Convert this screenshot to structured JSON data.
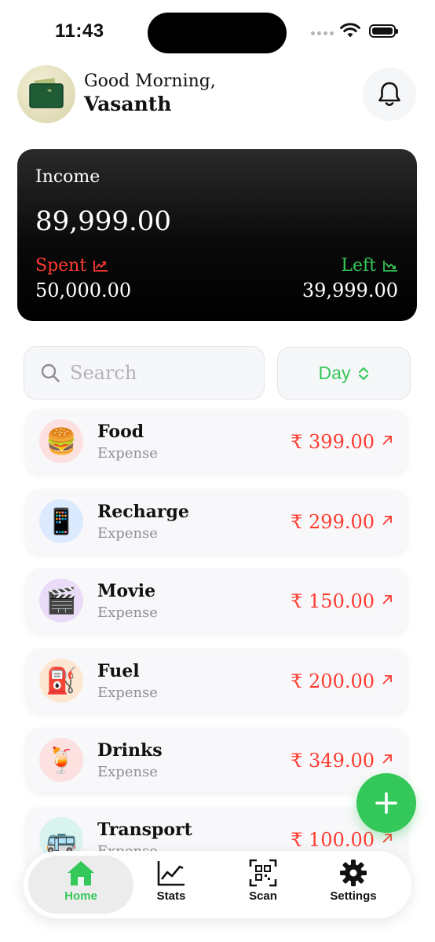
{
  "status_bar": {
    "time": "11:43"
  },
  "header": {
    "greeting": "Good Morning,",
    "username": "Vasanth"
  },
  "income_card": {
    "income_label": "Income",
    "income_value": "89,999.00",
    "spent_label": "Spent",
    "spent_value": "50,000.00",
    "left_label": "Left",
    "left_value": "39,999.00"
  },
  "search": {
    "placeholder": "Search"
  },
  "filter": {
    "selected": "Day"
  },
  "transactions": [
    {
      "name": "Food",
      "type": "Expense",
      "amount": "₹ 399.00",
      "emoji": "🍔",
      "bg": "#fde0e0"
    },
    {
      "name": "Recharge",
      "type": "Expense",
      "amount": "₹ 299.00",
      "emoji": "📱",
      "bg": "#dbeafe"
    },
    {
      "name": "Movie",
      "type": "Expense",
      "amount": "₹ 150.00",
      "emoji": "🎬",
      "bg": "#eadcf8"
    },
    {
      "name": "Fuel",
      "type": "Expense",
      "amount": "₹ 200.00",
      "emoji": "⛽",
      "bg": "#fde7d2"
    },
    {
      "name": "Drinks",
      "type": "Expense",
      "amount": "₹ 349.00",
      "emoji": "🍹",
      "bg": "#fde0e0"
    },
    {
      "name": "Transport",
      "type": "Expense",
      "amount": "₹ 100.00",
      "emoji": "🚌",
      "bg": "#d9f3ee"
    }
  ],
  "tabs": {
    "home": "Home",
    "stats": "Stats",
    "scan": "Scan",
    "settings": "Settings"
  },
  "colors": {
    "accent_green": "#34c759",
    "expense_red": "#ff3b30"
  }
}
